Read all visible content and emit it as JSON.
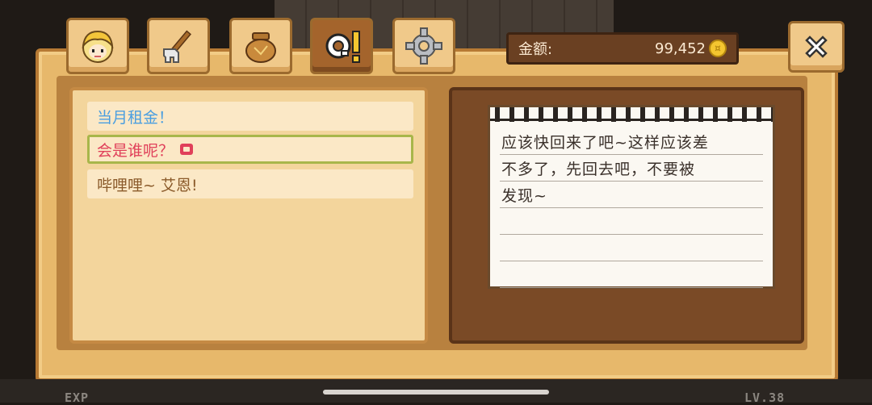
{
  "tabs": [
    {
      "name": "character",
      "icon": "blonde-character-icon"
    },
    {
      "name": "tools",
      "icon": "rake-icon"
    },
    {
      "name": "items",
      "icon": "sack-pot-icon"
    },
    {
      "name": "quest",
      "icon": "quest-q-icon"
    },
    {
      "name": "settings",
      "icon": "gear-icon"
    }
  ],
  "money": {
    "label": "金额:",
    "value": "99,452",
    "coin": "coin-icon"
  },
  "quests": [
    {
      "text": "当月租金！",
      "color": "#4a9ee0"
    },
    {
      "text": "会是谁呢？",
      "color": "#e0405a",
      "selected": true
    },
    {
      "text": "哔哩哩~ 艾恩!",
      "color": "#8a5a2a"
    }
  ],
  "note": {
    "lines": [
      "应该快回来了吧~这样应该差",
      "不多了，先回去吧，不要被",
      "发现~",
      "",
      "",
      ""
    ]
  },
  "footer": {
    "exp": "EXP",
    "level": "LV.38"
  },
  "colors": {
    "panel": "#e7b86b",
    "board": "#7a4a26",
    "selected_border": "#a8b64a"
  }
}
